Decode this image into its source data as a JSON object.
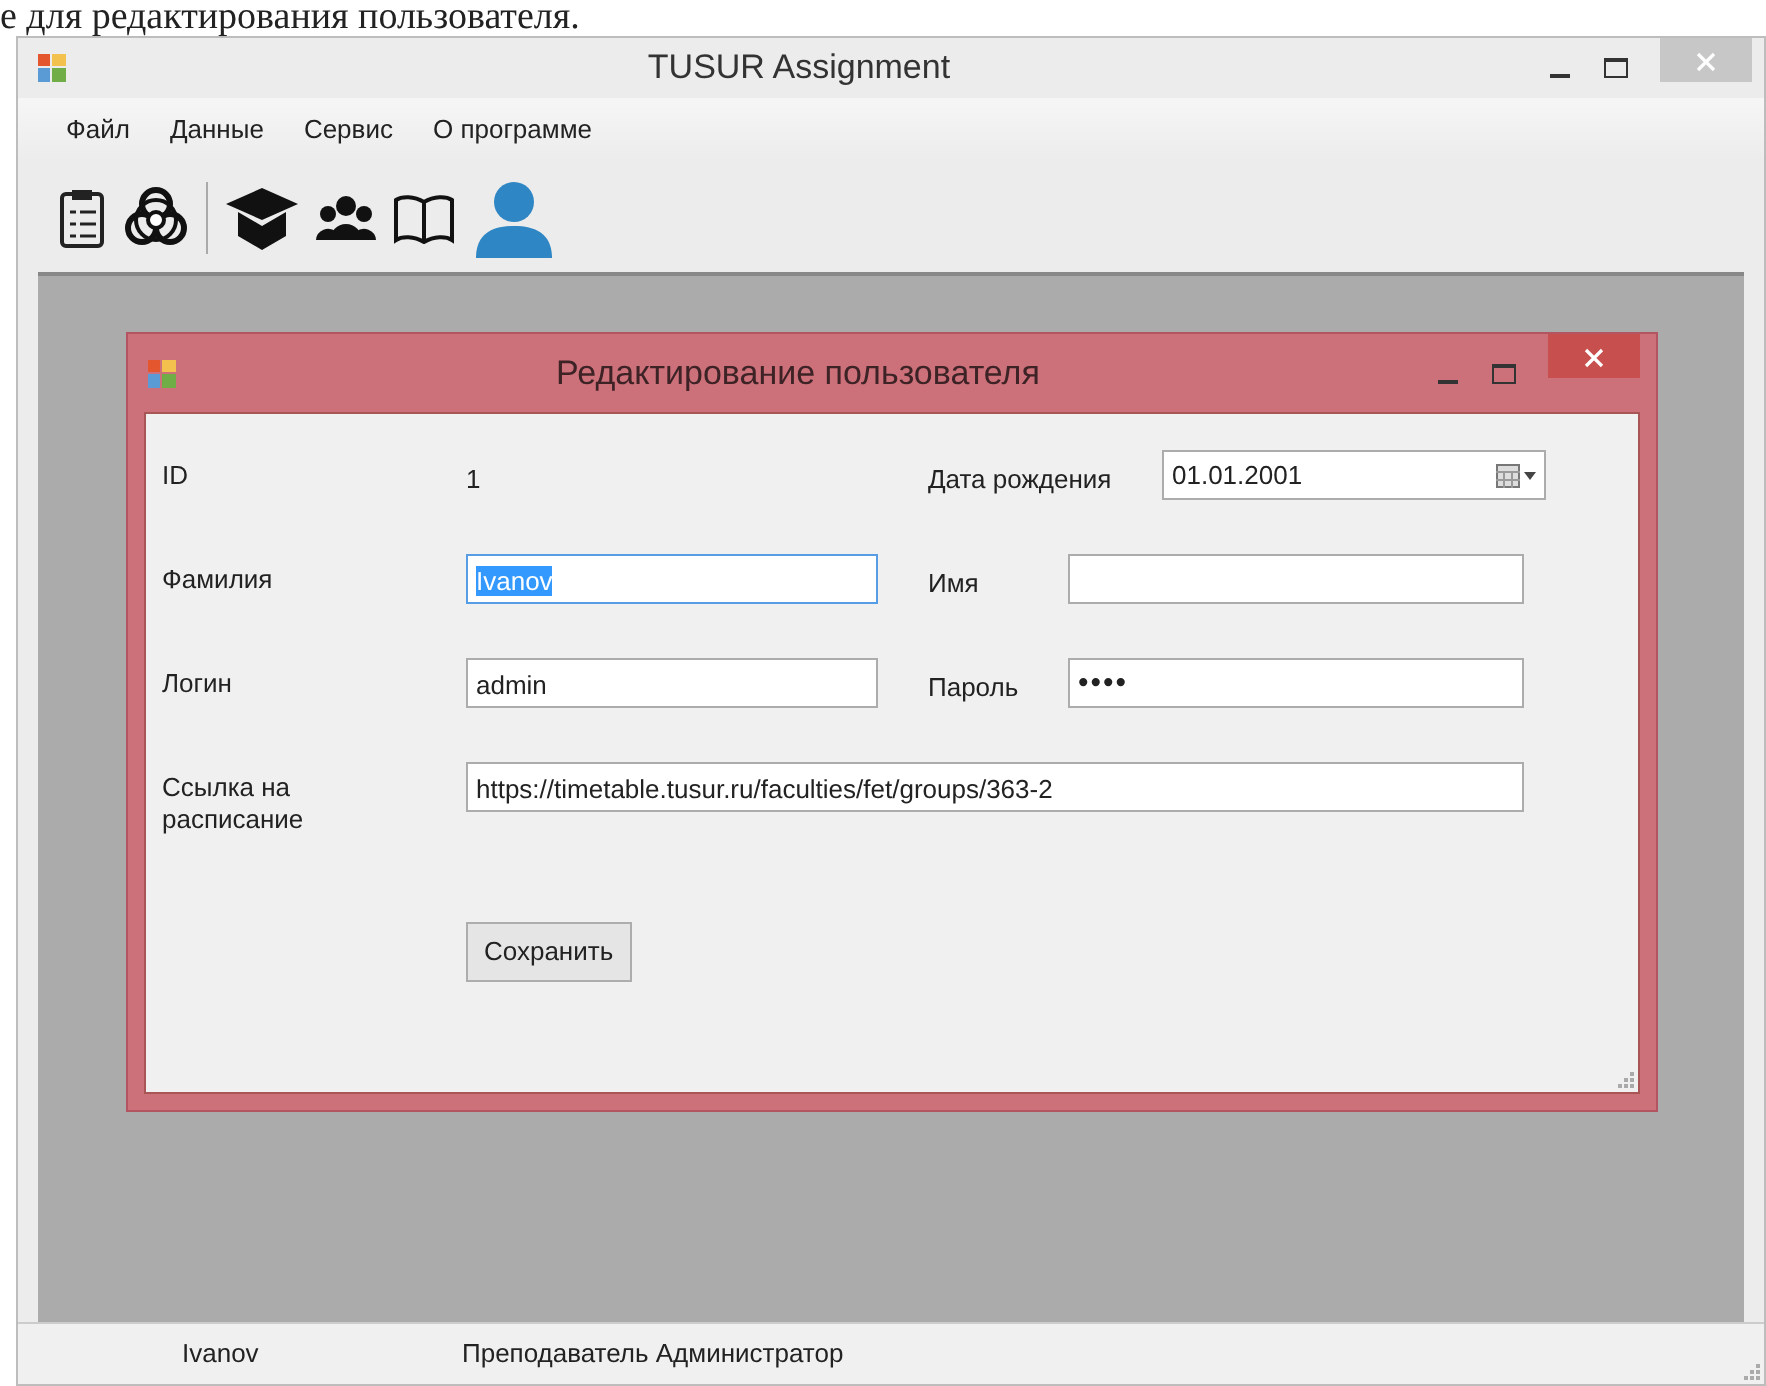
{
  "caption": "е для редактирования пользователя.",
  "window": {
    "title": "TUSUR Assignment"
  },
  "menu": [
    "Файл",
    "Данные",
    "Сервис",
    "О программе"
  ],
  "dialog": {
    "title": "Редактирование пользователя",
    "rows": [
      {
        "left": {
          "label": "ID",
          "kind": "text",
          "value": "1"
        },
        "right": {
          "label": "Дата рождения",
          "kind": "date",
          "value": "01.01.2001"
        }
      },
      {
        "left": {
          "label": "Фамилия",
          "kind": "input",
          "value": "Ivanov",
          "selected": true
        },
        "right": {
          "label": "Имя",
          "kind": "input",
          "selected": false
        }
      },
      {
        "left": {
          "label": "Логин",
          "kind": "input",
          "value": "admin",
          "selected": false
        },
        "right": {
          "label": "Пароль",
          "kind": "password",
          "value": "••••"
        }
      },
      {
        "left": {
          "label": "Ссылка на расписание",
          "kind": "wide",
          "value": "https://timetable.tusur.ru/faculties/fet/groups/363-2",
          "selected": false
        }
      }
    ],
    "button": "Сохранить"
  },
  "status_bar": [
    "Ivanov",
    "Преподаватель Администратор"
  ]
}
